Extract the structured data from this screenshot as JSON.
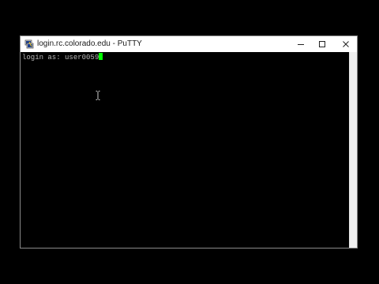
{
  "window": {
    "title": "login.rc.colorado.edu - PuTTY",
    "controls": {
      "minimize_icon": "minimize-icon",
      "maximize_icon": "maximize-icon",
      "close_icon": "close-icon"
    }
  },
  "terminal": {
    "prompt": "login as: ",
    "input": "user0059",
    "cursor_color": "#00ff00",
    "text_color": "#bbbbbb",
    "background": "#000000"
  },
  "mouse": {
    "cursor": "ibeam-cursor-icon"
  }
}
